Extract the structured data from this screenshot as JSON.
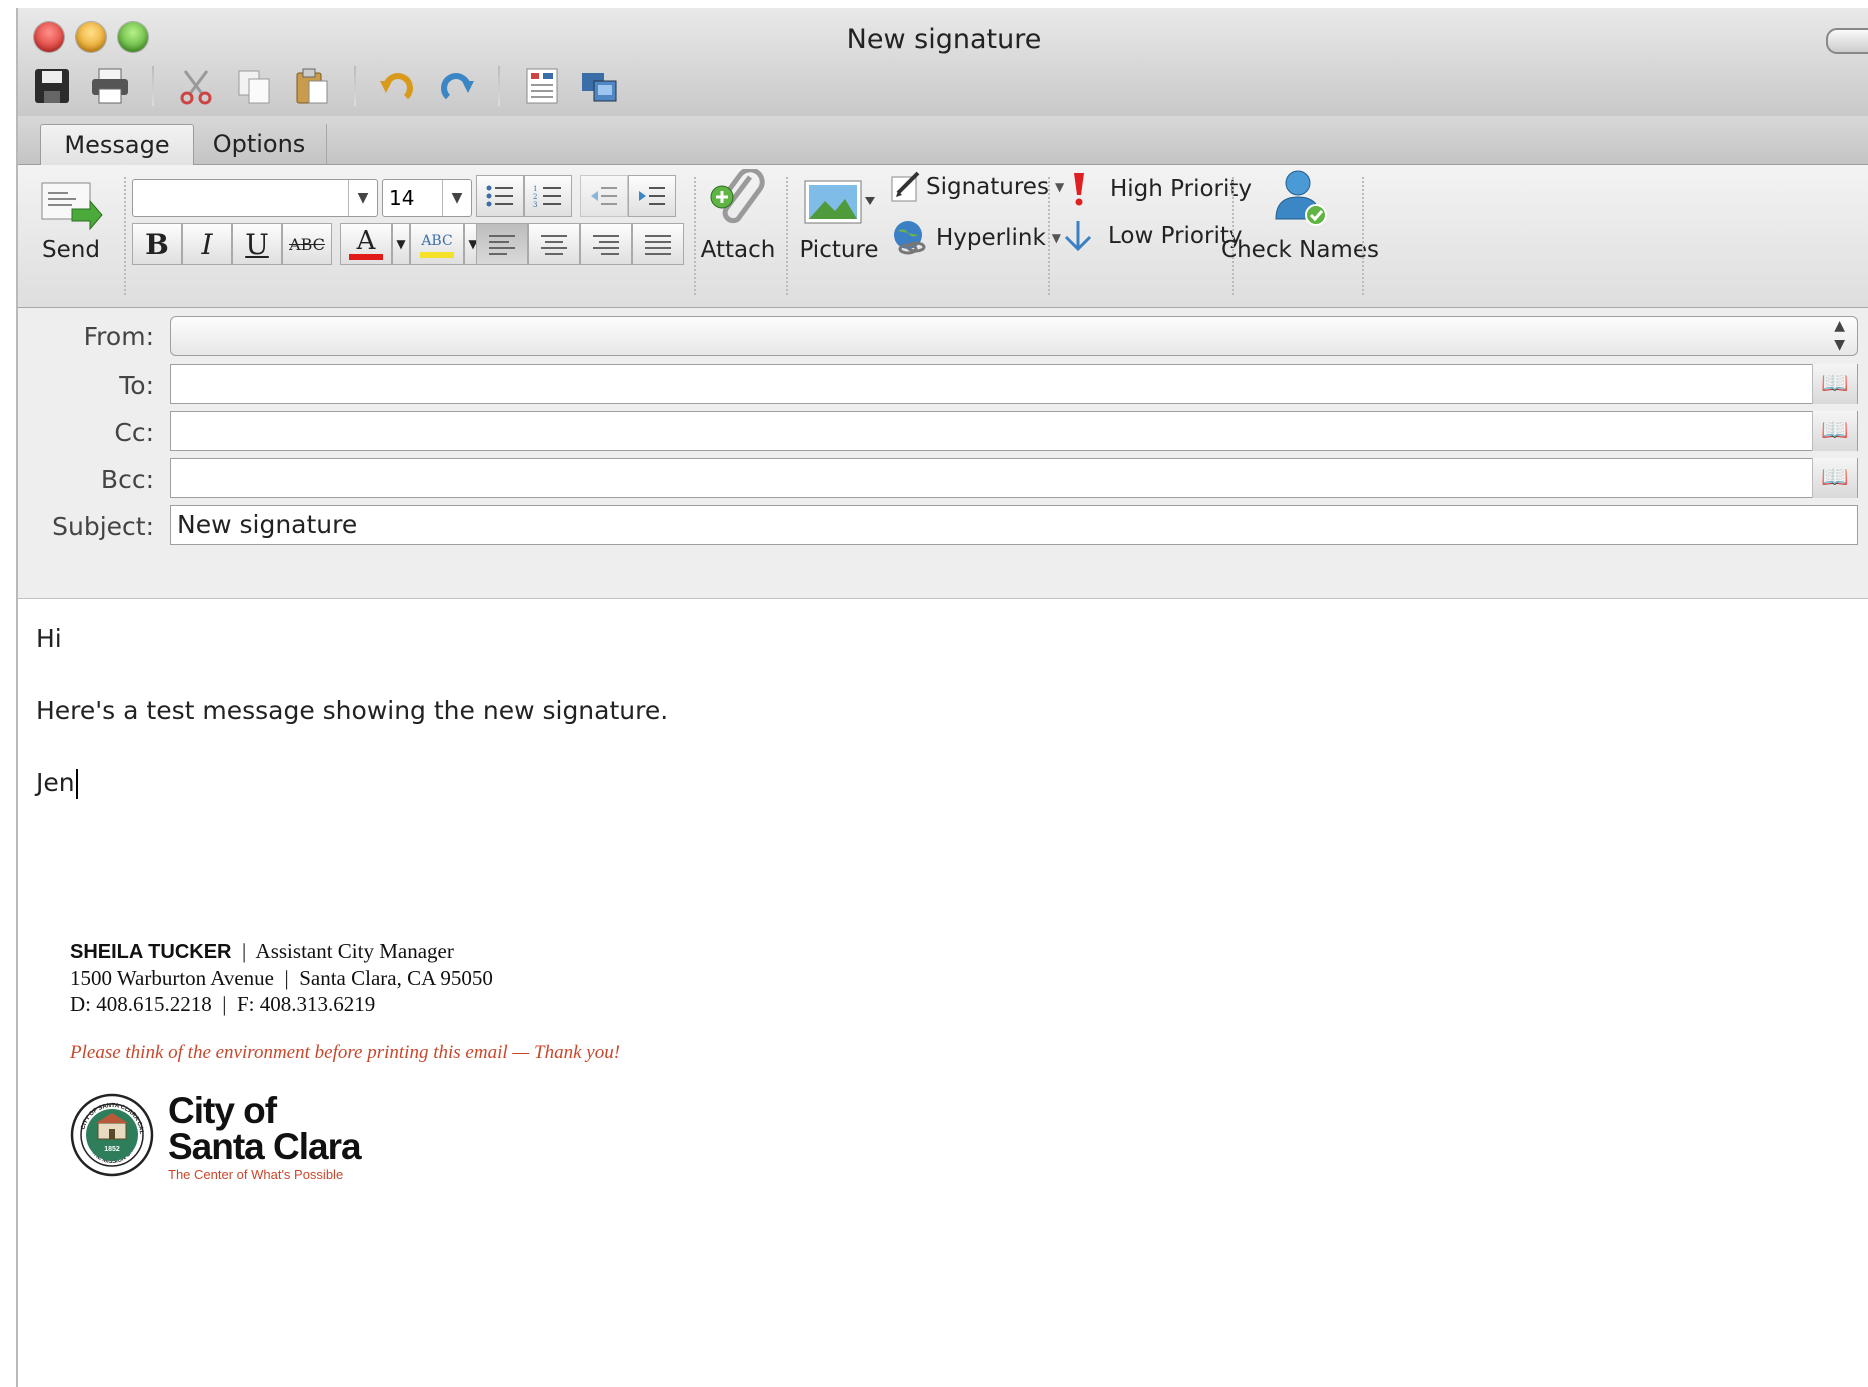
{
  "window": {
    "title": "New signature"
  },
  "tabs": [
    {
      "label": "Message"
    },
    {
      "label": "Options"
    }
  ],
  "ribbon": {
    "send_label": "Send",
    "font_name": "",
    "font_size": "14",
    "attach_label": "Attach",
    "picture_label": "Picture",
    "signatures_label": "Signatures",
    "hyperlink_label": "Hyperlink",
    "high_priority_label": "High Priority",
    "low_priority_label": "Low Priority",
    "check_names_label": "Check Names",
    "bold": "B",
    "italic": "I",
    "underline": "U",
    "strike": "ABC",
    "font_color": "A",
    "highlight": "ABC"
  },
  "header": {
    "from_label": "From:",
    "to_label": "To:",
    "cc_label": "Cc:",
    "bcc_label": "Bcc:",
    "subject_label": "Subject:",
    "from_value": "",
    "to_value": "",
    "cc_value": "",
    "bcc_value": "",
    "subject_value": "New signature"
  },
  "body": {
    "greeting": "Hi",
    "message": "Here's a test message showing the new signature.",
    "closing": "Jen"
  },
  "signature": {
    "name": "SHEILA TUCKER",
    "title": "Assistant City Manager",
    "address": "1500 Warburton Avenue",
    "city": "Santa Clara, CA 95050",
    "direct": "D: 408.615.2218",
    "fax": "F: 408.313.6219",
    "sep": "|",
    "environment_note": "Please think of the environment before printing this email — Thank  you!",
    "logo_line1": "City of",
    "logo_line2": "Santa Clara",
    "tagline": "The Center of What's Possible",
    "seal_top": "CITY OF SANTA CLARA CALIFORNIA",
    "seal_year": "1852",
    "seal_bottom": "THE MISSION CITY"
  },
  "colors": {
    "accent_red": "#c8472b",
    "seal_green": "#2e7d5b"
  }
}
